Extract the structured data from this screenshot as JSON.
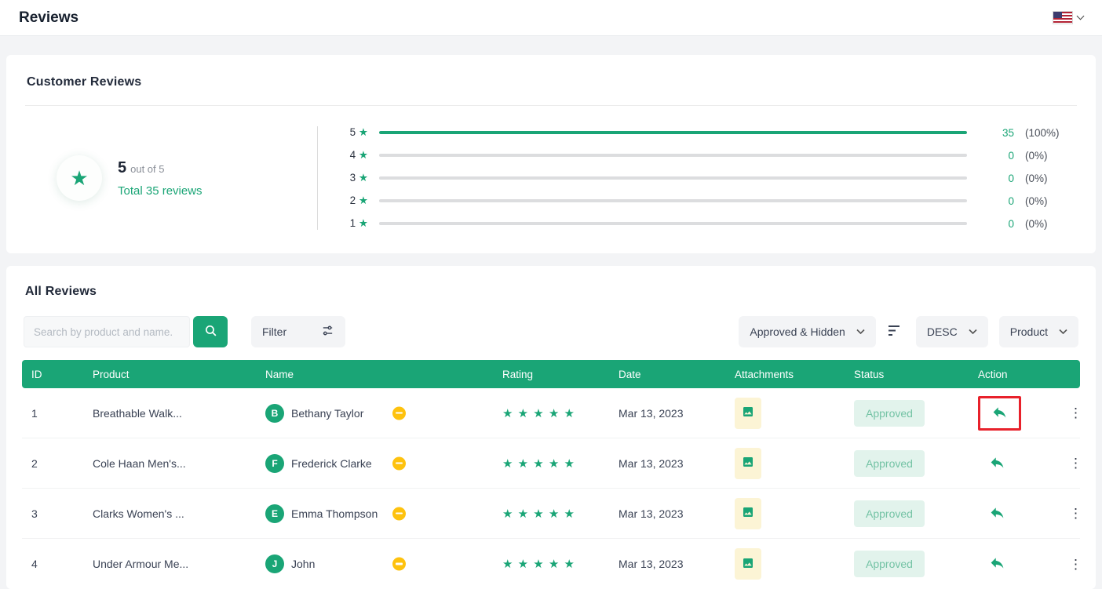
{
  "header": {
    "title": "Reviews",
    "language_icon": "us-flag-icon"
  },
  "summary": {
    "title": "Customer Reviews",
    "score": "5",
    "out_of": "out of 5",
    "total": "Total 35 reviews",
    "rows": [
      {
        "stars": "5",
        "fill": 100,
        "count": "35",
        "percent": "(100%)"
      },
      {
        "stars": "4",
        "fill": 0,
        "count": "0",
        "percent": "(0%)"
      },
      {
        "stars": "3",
        "fill": 0,
        "count": "0",
        "percent": "(0%)"
      },
      {
        "stars": "2",
        "fill": 0,
        "count": "0",
        "percent": "(0%)"
      },
      {
        "stars": "1",
        "fill": 0,
        "count": "0",
        "percent": "(0%)"
      }
    ]
  },
  "reviews": {
    "title": "All Reviews",
    "search_placeholder": "Search by product and name.",
    "search_icon": "search-icon",
    "filter_label": "Filter",
    "filter_icon": "sliders-icon",
    "status_filter": "Approved & Hidden",
    "sort_icon": "sort-lines-icon",
    "sort_dir": "DESC",
    "sort_by": "Product",
    "columns": [
      "ID",
      "Product",
      "Name",
      "Rating",
      "Date",
      "Attachments",
      "Status",
      "Action"
    ],
    "rows": [
      {
        "id": "1",
        "product": "Breathable Walk...",
        "initial": "B",
        "name": "Bethany Taylor",
        "rating": 5,
        "date": "Mar 13, 2023",
        "status": "Approved",
        "highlighted": true
      },
      {
        "id": "2",
        "product": "Cole Haan Men's...",
        "initial": "F",
        "name": "Frederick Clarke",
        "rating": 5,
        "date": "Mar 13, 2023",
        "status": "Approved",
        "highlighted": false
      },
      {
        "id": "3",
        "product": "Clarks Women's ...",
        "initial": "E",
        "name": "Emma Thompson",
        "rating": 5,
        "date": "Mar 13, 2023",
        "status": "Approved",
        "highlighted": false
      },
      {
        "id": "4",
        "product": "Under Armour Me...",
        "initial": "J",
        "name": "John",
        "rating": 5,
        "date": "Mar 13, 2023",
        "status": "Approved",
        "highlighted": false
      }
    ]
  },
  "colors": {
    "accent": "#1aa576",
    "badge_bg": "#e2f3ec",
    "badge_text": "#74c3a5",
    "indicator_yellow": "#fec20e",
    "annotation_red": "#e8212b",
    "attachment_bg": "#fcf4d5"
  }
}
